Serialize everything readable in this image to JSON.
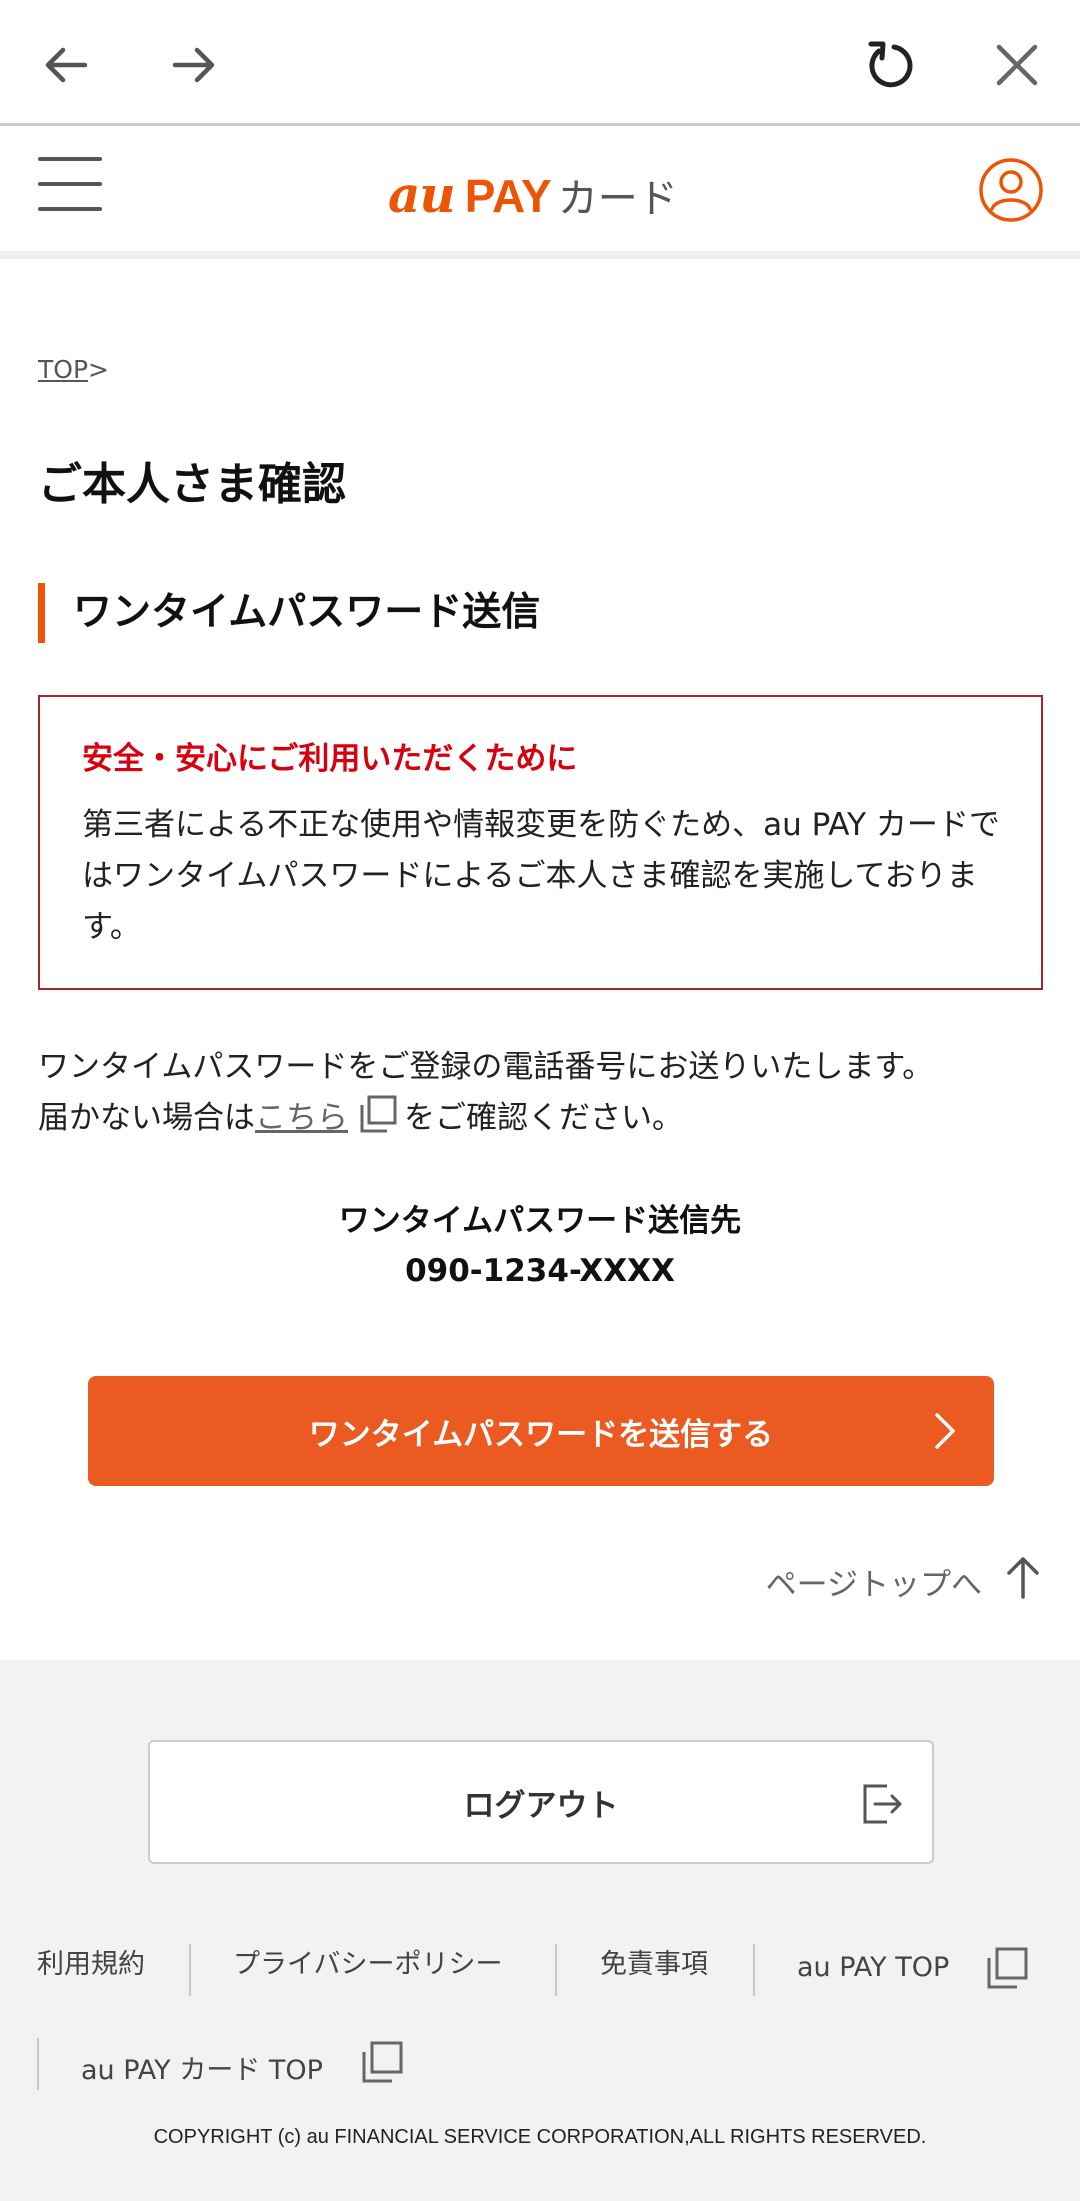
{
  "browser": {
    "back_icon": "arrow-left-icon",
    "forward_icon": "arrow-right-icon",
    "reload_icon": "reload-icon",
    "close_icon": "close-icon"
  },
  "header": {
    "logo_au": "au",
    "logo_pay": "PAY",
    "logo_card": "カード",
    "menu_icon": "hamburger-menu-icon",
    "account_icon": "user-account-icon"
  },
  "breadcrumb": {
    "top": "TOP",
    "separator": ">"
  },
  "page": {
    "title": "ご本人さま確認",
    "section_title": "ワンタイムパスワード送信"
  },
  "notice": {
    "title": "安全・安心にご利用いただくために",
    "body": "第三者による不正な使用や情報変更を防ぐため、au PAY カードではワンタイムパスワードによるご本人さま確認を実施しております。"
  },
  "info": {
    "line1": "ワンタイムパスワードをご登録の電話番号にお送りいたします。",
    "line2_prefix": "届かない場合は",
    "link": "こちら",
    "line2_suffix": "をご確認ください。"
  },
  "destination": {
    "label": "ワンタイムパスワード送信先",
    "phone": "090-1234-XXXX"
  },
  "buttons": {
    "send_otp": "ワンタイムパスワードを送信する",
    "page_top": "ページトップへ",
    "logout": "ログアウト"
  },
  "footer": {
    "links": [
      "利用規約",
      "プライバシーポリシー",
      "免責事項",
      "au PAY TOP",
      "au PAY カード TOP"
    ],
    "copyright": "COPYRIGHT (c) au FINANCIAL SERVICE CORPORATION,ALL RIGHTS RESERVED."
  },
  "colors": {
    "brand_orange": "#eb5505",
    "button_orange": "#eb5a20",
    "notice_border": "#a0282d",
    "notice_title": "#d6000f",
    "footer_bg": "#f2f2f2"
  }
}
